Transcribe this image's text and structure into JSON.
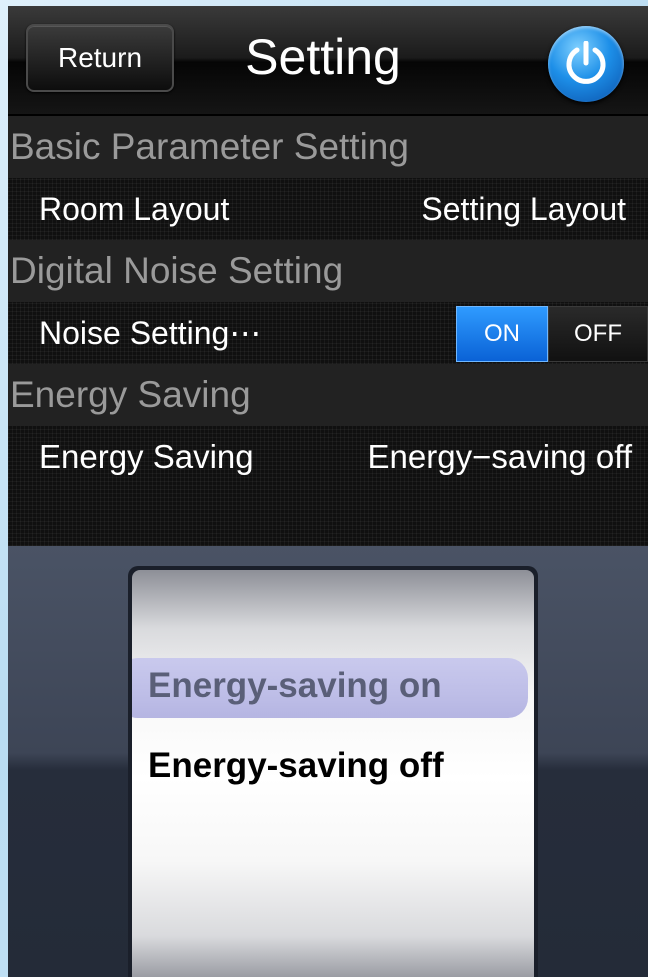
{
  "header": {
    "return_label": "Return",
    "title": "Setting",
    "power_icon": "power-icon"
  },
  "sections": {
    "basic": {
      "title": "Basic Parameter Setting",
      "row_label": "Room Layout",
      "row_value": "Setting Layout"
    },
    "noise": {
      "title": "Digital Noise Setting",
      "row_label": "Noise Setting⋯",
      "toggle_on": "ON",
      "toggle_off": "OFF",
      "selected": "ON"
    },
    "energy": {
      "title": "Energy Saving",
      "row_label": "Energy Saving",
      "row_value": "Energy−saving off"
    }
  },
  "picker": {
    "options": [
      "Energy-saving on",
      "Energy-saving off"
    ],
    "highlighted": "Energy-saving on"
  },
  "colors": {
    "accent": "#0a62d6",
    "highlight": "#b0b0e6"
  }
}
